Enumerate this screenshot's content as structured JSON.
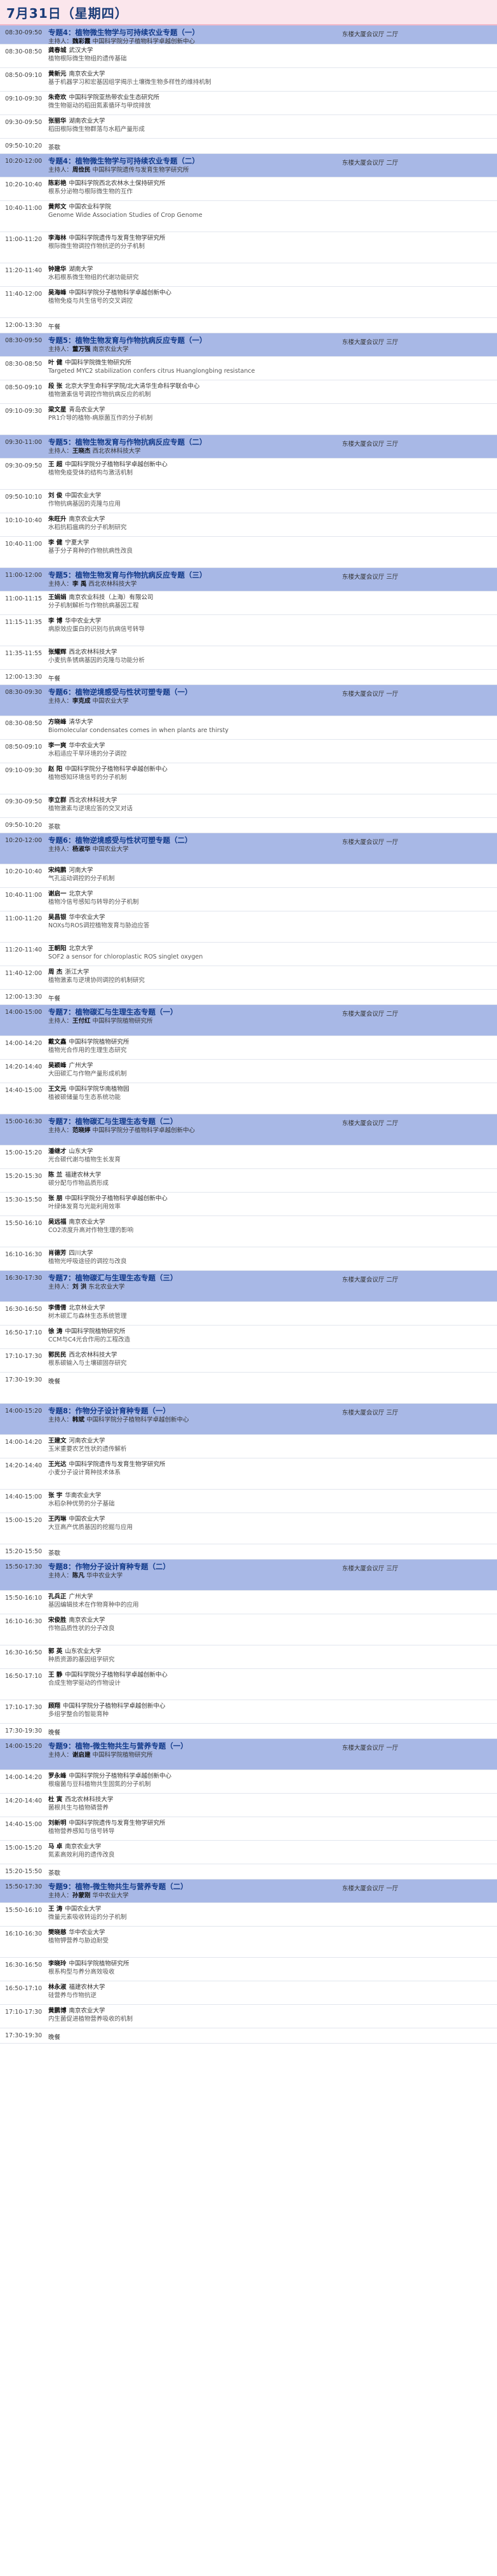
{
  "header": {
    "date": "7月31日（星期四）"
  },
  "rows": [
    {
      "k": "s",
      "h": 30,
      "time": "08:30-09:50",
      "title": "专题4：植物微生物学与可持续农业专题（一）",
      "chair": "主持人：",
      "chair_name": "魏彩霞",
      "chair_org": "中国科学院分子植物科学卓越创新中心",
      "venue": "东楼大厦会议厅 二厅"
    },
    {
      "k": "t",
      "h": 37,
      "time": "08:30-08:50",
      "name": "龚春城",
      "org": "武汉大学",
      "talk": "植物根际微生物组的遗传基础"
    },
    {
      "k": "t",
      "h": 37,
      "time": "08:50-09:10",
      "name": "黄新元",
      "org": "南京农业大学",
      "talk": "基于机器学习和宏基因组学揭示土壤微生物多样性的维持机制"
    },
    {
      "k": "t",
      "h": 37,
      "time": "09:10-09:30",
      "name": "朱奇欢",
      "org": "中国科学院亚热带农业生态研究所",
      "talk": "微生物驱动的稻田氮素循环与甲烷排放"
    },
    {
      "k": "t",
      "h": 37,
      "time": "09:30-09:50",
      "name": "张丽华",
      "org": "湖南农业大学",
      "talk": "稻田根际微生物群落与水稻产量形成"
    },
    {
      "k": "b",
      "h": 24,
      "time": "09:50-10:20",
      "label": "茶歇"
    },
    {
      "k": "s",
      "h": 37,
      "time": "10:20-12:00",
      "title": "专题4：植物微生物学与可持续农业专题（二）",
      "chair": "主持人：",
      "chair_name": "周俭民",
      "chair_org": "中国科学院遗传与发育生物学研究所",
      "venue": "东楼大厦会议厅 二厅"
    },
    {
      "k": "t",
      "h": 37,
      "time": "10:20-10:40",
      "name": "陈彩艳",
      "org": "中国科学院西北农林水土保持研究所",
      "talk": "根系分泌物与根际微生物的互作"
    },
    {
      "k": "t",
      "h": 49,
      "time": "10:40-11:00",
      "name": "黄邦文",
      "org": "中国农业科学院",
      "talk": "Genome Wide Association Studies of Crop Genome"
    },
    {
      "k": "t",
      "h": 49,
      "time": "11:00-11:20",
      "name": "李海林",
      "org": "中国科学院遗传与发育生物学研究所",
      "talk": "根际微生物调控作物抗逆的分子机制"
    },
    {
      "k": "t",
      "h": 37,
      "time": "11:20-11:40",
      "name": "钟建华",
      "org": "湖南大学",
      "talk": "水稻根系微生物组的代谢功能研究"
    },
    {
      "k": "t",
      "h": 49,
      "time": "11:40-12:00",
      "name": "吴海峰",
      "org": "中国科学院分子植物科学卓越创新中心",
      "talk": "植物免疫与共生信号的交叉调控"
    },
    {
      "k": "b",
      "h": 24,
      "time": "12:00-13:30",
      "label": "午餐"
    },
    {
      "k": "s",
      "h": 37,
      "time": "08:30-09:50",
      "title": "专题5：植物生物发育与作物抗病反应专题（一）",
      "chair": "主持人：",
      "chair_name": "董万强",
      "chair_org": "南京农业大学",
      "venue": "东楼大厦会议厅 三厅"
    },
    {
      "k": "t",
      "h": 37,
      "time": "08:30-08:50",
      "name": "叶 健",
      "org": "中国科学院微生物研究所",
      "talk": "Targeted MYC2 stabilization confers citrus Huanglongbing resistance"
    },
    {
      "k": "t",
      "h": 37,
      "time": "08:50-09:10",
      "name": "段 张",
      "org": "北京大学生命科学学院/北大清华生命科学联合中心",
      "talk": "植物激素信号调控作物抗病反应的机制"
    },
    {
      "k": "t",
      "h": 49,
      "time": "09:10-09:30",
      "name": "梁文星",
      "org": "青岛农业大学",
      "talk": "PR1介导的植物-病原菌互作的分子机制"
    },
    {
      "k": "s",
      "h": 37,
      "time": "09:30-11:00",
      "title": "专题5：植物生物发育与作物抗病反应专题（二）",
      "chair": "主持人：",
      "chair_name": "王晓杰",
      "chair_org": "西北农林科技大学",
      "venue": "东楼大厦会议厅 三厅"
    },
    {
      "k": "t",
      "h": 49,
      "time": "09:30-09:50",
      "name": "王 超",
      "org": "中国科学院分子植物科学卓越创新中心",
      "talk": "植物免疫受体的结构与激活机制"
    },
    {
      "k": "t",
      "h": 37,
      "time": "09:50-10:10",
      "name": "刘 俊",
      "org": "中国农业大学",
      "talk": "作物抗病基因的克隆与应用"
    },
    {
      "k": "t",
      "h": 37,
      "time": "10:10-10:40",
      "name": "朱旺升",
      "org": "南京农业大学",
      "talk": "水稻抗稻瘟病的分子机制研究"
    },
    {
      "k": "t",
      "h": 49,
      "time": "10:40-11:00",
      "name": "李 健",
      "org": "宁夏大学",
      "talk": "基于分子育种的作物抗病性改良"
    },
    {
      "k": "s",
      "h": 37,
      "time": "11:00-12:00",
      "title": "专题5：植物生物发育与作物抗病反应专题（三）",
      "chair": "主持人：",
      "chair_name": "李 禹",
      "chair_org": "西北农林科技大学",
      "venue": "东楼大厦会议厅 三厅"
    },
    {
      "k": "t",
      "h": 37,
      "time": "11:00-11:15",
      "name": "王娟娟",
      "org": "南京农业科技（上海）有限公司",
      "talk": "分子机制解析与作物抗病基因工程"
    },
    {
      "k": "t",
      "h": 49,
      "time": "11:15-11:35",
      "name": "李 博",
      "org": "华中农业大学",
      "talk": "病原效应蛋白的识别与抗病信号转导"
    },
    {
      "k": "t",
      "h": 37,
      "time": "11:35-11:55",
      "name": "张耀辉",
      "org": "西北农林科技大学",
      "talk": "小麦抗条锈病基因的克隆与功能分析"
    },
    {
      "k": "b",
      "h": 24,
      "time": "12:00-13:30",
      "label": "午餐"
    },
    {
      "k": "s",
      "h": 49,
      "time": "08:30-09:30",
      "title": "专题6：植物逆境感受与性状可塑专题（一）",
      "chair": "主持人：",
      "chair_name": "李克成",
      "chair_org": "中国农业大学",
      "venue": "东楼大厦会议厅 一厅"
    },
    {
      "k": "t",
      "h": 37,
      "time": "08:30-08:50",
      "name": "方晓峰",
      "org": "清华大学",
      "talk": "Biomolecular condensates comes in when plants are thirsty"
    },
    {
      "k": "t",
      "h": 37,
      "time": "08:50-09:10",
      "name": "李一爽",
      "org": "华中农业大学",
      "talk": "水稻适应干旱环境的分子调控"
    },
    {
      "k": "t",
      "h": 49,
      "time": "09:10-09:30",
      "name": "赵 阳",
      "org": "中国科学院分子植物科学卓越创新中心",
      "talk": "植物感知环境信号的分子机制"
    },
    {
      "k": "t",
      "h": 37,
      "time": "09:30-09:50",
      "name": "李立群",
      "org": "西北农林科技大学",
      "talk": "植物激素与逆境应答的交叉对话"
    },
    {
      "k": "b",
      "h": 24,
      "time": "09:50-10:20",
      "label": "茶歇"
    },
    {
      "k": "s",
      "h": 49,
      "time": "10:20-12:00",
      "title": "专题6：植物逆境感受与性状可塑专题（二）",
      "chair": "主持人：",
      "chair_name": "杨淑华",
      "chair_org": "中国农业大学",
      "venue": "东楼大厦会议厅 一厅"
    },
    {
      "k": "t",
      "h": 37,
      "time": "10:20-10:40",
      "name": "宋纯鹏",
      "org": "河南大学",
      "talk": "气孔运动调控的分子机制"
    },
    {
      "k": "t",
      "h": 37,
      "time": "10:40-11:00",
      "name": "谢启一",
      "org": "北京大学",
      "talk": "植物冷信号感知与转导的分子机制"
    },
    {
      "k": "t",
      "h": 49,
      "time": "11:00-11:20",
      "name": "吴昌银",
      "org": "华中农业大学",
      "talk": "NOXs与ROS调控植物发育与胁迫应答"
    },
    {
      "k": "t",
      "h": 37,
      "time": "11:20-11:40",
      "name": "王朝阳",
      "org": "北京大学",
      "talk": "SOF2 a sensor for chloroplastic ROS singlet oxygen"
    },
    {
      "k": "t",
      "h": 37,
      "time": "11:40-12:00",
      "name": "周 杰",
      "org": "浙江大学",
      "talk": "植物激素与逆境协同调控的机制研究"
    },
    {
      "k": "b",
      "h": 24,
      "time": "12:00-13:30",
      "label": "午餐"
    },
    {
      "k": "s",
      "h": 49,
      "time": "14:00-15:00",
      "title": "专题7：植物碳汇与生理生态专题（一）",
      "chair": "主持人：",
      "chair_name": "王付红",
      "chair_org": "中国科学院植物研究所",
      "venue": "东楼大厦会议厅 二厅"
    },
    {
      "k": "t",
      "h": 37,
      "time": "14:00-14:20",
      "name": "戴文鑫",
      "org": "中国科学院植物研究所",
      "talk": "植物光合作用的生理生态研究"
    },
    {
      "k": "t",
      "h": 37,
      "time": "14:20-14:40",
      "name": "吴颖峰",
      "org": "广州大学",
      "talk": "大田碳汇与作物产量形成机制"
    },
    {
      "k": "t",
      "h": 49,
      "time": "14:40-15:00",
      "name": "王文元",
      "org": "中国科学院华南植物园",
      "talk": "植被碳储量与生态系统功能"
    },
    {
      "k": "s",
      "h": 49,
      "time": "15:00-16:30",
      "title": "专题7：植物碳汇与生理生态专题（二）",
      "chair": "主持人：",
      "chair_name": "范晓婷",
      "chair_org": "中国科学院分子植物科学卓越创新中心",
      "venue": "东楼大厦会议厅 二厅"
    },
    {
      "k": "t",
      "h": 37,
      "time": "15:00-15:20",
      "name": "潘继才",
      "org": "山东大学",
      "talk": "光合碳代谢与植物生长发育"
    },
    {
      "k": "t",
      "h": 37,
      "time": "15:20-15:30",
      "name": "陈 兰",
      "org": "福建农林大学",
      "talk": "碳分配与作物品质形成"
    },
    {
      "k": "t",
      "h": 37,
      "time": "15:30-15:50",
      "name": "张 朋",
      "org": "中国科学院分子植物科学卓越创新中心",
      "talk": "叶绿体发育与光能利用效率"
    },
    {
      "k": "t",
      "h": 49,
      "time": "15:50-16:10",
      "name": "吴远福",
      "org": "南京农业大学",
      "talk": "CO2浓度升高对作物生理的影响"
    },
    {
      "k": "t",
      "h": 37,
      "time": "16:10-16:30",
      "name": "肖德芳",
      "org": "四川大学",
      "talk": "植物光呼吸途径的调控与改良"
    },
    {
      "k": "s",
      "h": 49,
      "time": "16:30-17:30",
      "title": "专题7：植物碳汇与生理生态专题（三）",
      "chair": "主持人：",
      "chair_name": "刘 洪",
      "chair_org": "东北农业大学",
      "venue": "东楼大厦会议厅 二厅"
    },
    {
      "k": "t",
      "h": 37,
      "time": "16:30-16:50",
      "name": "李倩倩",
      "org": "北京林业大学",
      "talk": "树木碳汇与森林生态系统管理"
    },
    {
      "k": "t",
      "h": 37,
      "time": "16:50-17:10",
      "name": "徐 涛",
      "org": "中国科学院植物研究所",
      "talk": "CCM与C4光合作用的工程改造"
    },
    {
      "k": "t",
      "h": 37,
      "time": "17:10-17:30",
      "name": "郭民民",
      "org": "西北农林科技大学",
      "talk": "根系碳输入与土壤碳固存研究"
    },
    {
      "k": "b",
      "h": 49,
      "time": "17:30-19:30",
      "label": "晚餐"
    },
    {
      "k": "s",
      "h": 49,
      "time": "14:00-15:20",
      "title": "专题8：作物分子设计育种专题（一）",
      "chair": "主持人：",
      "chair_name": "韩斌",
      "chair_org": "中国科学院分子植物科学卓越创新中心",
      "venue": "东楼大厦会议厅 三厅"
    },
    {
      "k": "t",
      "h": 37,
      "time": "14:00-14:20",
      "name": "王建文",
      "org": "河南农业大学",
      "talk": "玉米重要农艺性状的遗传解析"
    },
    {
      "k": "t",
      "h": 49,
      "time": "14:20-14:40",
      "name": "王光达",
      "org": "中国科学院遗传与发育生物学研究所",
      "talk": "小麦分子设计育种技术体系"
    },
    {
      "k": "t",
      "h": 37,
      "time": "14:40-15:00",
      "name": "张 宇",
      "org": "华南农业大学",
      "talk": "水稻杂种优势的分子基础"
    },
    {
      "k": "t",
      "h": 49,
      "time": "15:00-15:20",
      "name": "王丙琳",
      "org": "中国农业大学",
      "talk": "大豆高产优质基因的挖掘与应用"
    },
    {
      "k": "b",
      "h": 24,
      "time": "15:20-15:50",
      "label": "茶歇"
    },
    {
      "k": "s",
      "h": 49,
      "time": "15:50-17:30",
      "title": "专题8：作物分子设计育种专题（二）",
      "chair": "主持人：",
      "chair_name": "陈凡",
      "chair_org": "华中农业大学",
      "venue": "东楼大厦会议厅 三厅"
    },
    {
      "k": "t",
      "h": 37,
      "time": "15:50-16:10",
      "name": "孔兵正",
      "org": "广州大学",
      "talk": "基因编辑技术在作物育种中的应用"
    },
    {
      "k": "t",
      "h": 49,
      "time": "16:10-16:30",
      "name": "宋俊胜",
      "org": "南京农业大学",
      "talk": "作物品质性状的分子改良"
    },
    {
      "k": "t",
      "h": 37,
      "time": "16:30-16:50",
      "name": "郭 英",
      "org": "山东农业大学",
      "talk": "种质资源的基因组学研究"
    },
    {
      "k": "t",
      "h": 49,
      "time": "16:50-17:10",
      "name": "王 静",
      "org": "中国科学院分子植物科学卓越创新中心",
      "talk": "合成生物学驱动的作物设计"
    },
    {
      "k": "t",
      "h": 37,
      "time": "17:10-17:30",
      "name": "顾翔",
      "org": "中国科学院分子植物科学卓越创新中心",
      "talk": "多组学整合的智能育种"
    },
    {
      "k": "b",
      "h": 24,
      "time": "17:30-19:30",
      "label": "晚餐"
    },
    {
      "k": "s",
      "h": 49,
      "time": "14:00-15:20",
      "title": "专题9：植物-微生物共生与营养专题（一）",
      "chair": "主持人：",
      "chair_name": "谢启建",
      "chair_org": "中国科学院植物研究所",
      "venue": "东楼大厦会议厅 一厅"
    },
    {
      "k": "t",
      "h": 37,
      "time": "14:00-14:20",
      "name": "罗永峰",
      "org": "中国科学院分子植物科学卓越创新中心",
      "talk": "根瘤菌与豆科植物共生固氮的分子机制"
    },
    {
      "k": "t",
      "h": 37,
      "time": "14:20-14:40",
      "name": "杜 寅",
      "org": "西北农林科技大学",
      "talk": "菌根共生与植物磷营养"
    },
    {
      "k": "t",
      "h": 37,
      "time": "14:40-15:00",
      "name": "刘新明",
      "org": "中国科学院遗传与发育生物学研究所",
      "talk": "植物营养感知与信号转导"
    },
    {
      "k": "t",
      "h": 37,
      "time": "15:00-15:20",
      "name": "马 卓",
      "org": "南京农业大学",
      "talk": "氮素高效利用的遗传改良"
    },
    {
      "k": "b",
      "h": 24,
      "time": "15:20-15:50",
      "label": "茶歇"
    },
    {
      "k": "s",
      "h": 37,
      "time": "15:50-17:30",
      "title": "专题9：植物-微生物共生与营养专题（二）",
      "chair": "主持人：",
      "chair_name": "孙蒙刚",
      "chair_org": "华中农业大学",
      "venue": "东楼大厦会议厅 一厅"
    },
    {
      "k": "t",
      "h": 37,
      "time": "15:50-16:10",
      "name": "王 涛",
      "org": "中国农业大学",
      "talk": "微量元素吸收转运的分子机制"
    },
    {
      "k": "t",
      "h": 49,
      "time": "16:10-16:30",
      "name": "樊晓慈",
      "org": "华中农业大学",
      "talk": "植物钾营养与胁迫耐受"
    },
    {
      "k": "t",
      "h": 37,
      "time": "16:30-16:50",
      "name": "李晓玲",
      "org": "中国科学院植物研究所",
      "talk": "根系构型与养分高效吸收"
    },
    {
      "k": "t",
      "h": 37,
      "time": "16:50-17:10",
      "name": "林永淑",
      "org": "福建农林大学",
      "talk": "硅营养与作物抗逆"
    },
    {
      "k": "t",
      "h": 37,
      "time": "17:10-17:30",
      "name": "黄鹏博",
      "org": "南京农业大学",
      "talk": "内生菌促进植物营养吸收的机制"
    },
    {
      "k": "b",
      "h": 24,
      "time": "17:30-19:30",
      "label": "晚餐"
    }
  ]
}
